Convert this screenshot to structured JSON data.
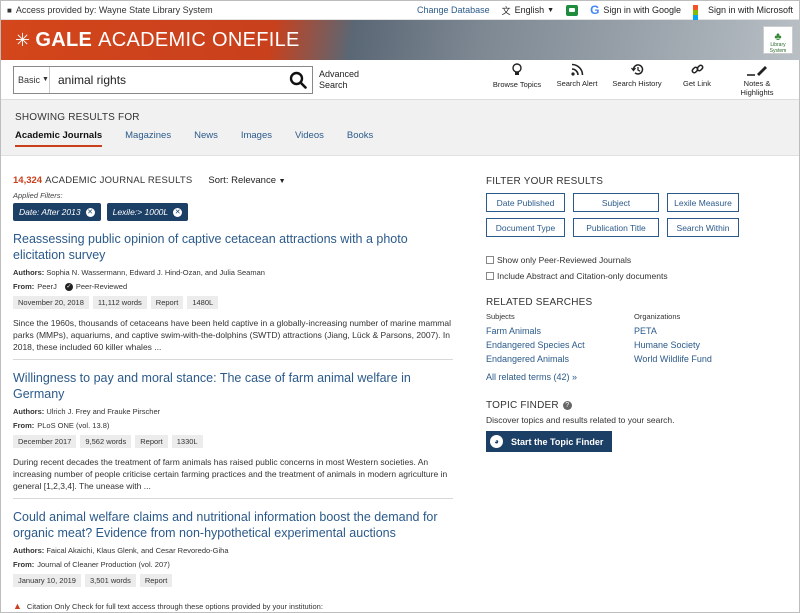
{
  "topbar": {
    "access_text": "Access provided by: Wayne State Library System",
    "change_db": "Change Database",
    "language": "English",
    "google_signin": "Sign in with Google",
    "ms_signin": "Sign in with Microsoft"
  },
  "header": {
    "brand_bold": "GALE",
    "brand_rest": "ACADEMIC ONEFILE",
    "library_logo_text": "Library System"
  },
  "search": {
    "mode": "Basic",
    "query": "animal rights",
    "advanced_line1": "Advanced",
    "advanced_line2": "Search"
  },
  "tools": [
    {
      "label": "Browse Topics",
      "icon": "lightbulb-icon"
    },
    {
      "label": "Search Alert",
      "icon": "rss-icon"
    },
    {
      "label": "Search History",
      "icon": "history-icon"
    },
    {
      "label": "Get Link",
      "icon": "link-icon"
    },
    {
      "label": "Notes & Highlights",
      "icon": "pen-icon"
    }
  ],
  "results_for": {
    "label": "SHOWING RESULTS FOR",
    "tabs": [
      "Academic Journals",
      "Magazines",
      "News",
      "Images",
      "Videos",
      "Books"
    ],
    "active_tab": "Academic Journals"
  },
  "results_header": {
    "count": "14,324",
    "label": "ACADEMIC JOURNAL RESULTS",
    "sort": "Sort: Relevance",
    "applied_label": "Applied Filters:",
    "filters": [
      "Date: After 2013",
      "Lexile:> 1000L"
    ]
  },
  "results": [
    {
      "title": "Reassessing public opinion of captive cetacean attractions with a photo elicitation survey",
      "authors_label": "Authors:",
      "authors": "Sophia N. Wassermann, Edward J. Hind-Ozan, and Julia Seaman",
      "from_label": "From:",
      "from": "PeerJ",
      "peer_reviewed": "Peer-Reviewed",
      "meta": [
        "November 20, 2018",
        "11,112 words",
        "Report",
        "1480L"
      ],
      "snippet": "Since the 1960s, thousands of cetaceans have been held captive in a globally-increasing number of marine mammal parks (MMPs), aquariums, and captive swim-with-the-dolphins (SWTD) attractions (Jiang, Lück & Parsons, 2007). In 2018, these included 60 killer whales ..."
    },
    {
      "title": "Willingness to pay and moral stance: The case of farm animal welfare in Germany",
      "authors_label": "Authors:",
      "authors": "Ulrich J. Frey and Frauke Pirscher",
      "from_label": "From:",
      "from": "PLoS ONE (vol. 13.8)",
      "meta": [
        "December 2017",
        "9,562 words",
        "Report",
        "1330L"
      ],
      "snippet": "During recent decades the treatment of farm animals has raised public concerns in most Western societies. An increasing number of people criticise certain farming practices and the treatment of animals in modern agriculture in general [1,2,3,4]. The unease with ..."
    },
    {
      "title": "Could animal welfare claims and nutritional information boost the demand for organic meat? Evidence from non-hypothetical experimental auctions",
      "authors_label": "Authors:",
      "authors": "Faical Akaichi, Klaus Glenk, and Cesar Revoredo-Giha",
      "from_label": "From:",
      "from": "Journal of Cleaner Production (vol. 207)",
      "meta": [
        "January 10, 2019",
        "3,501 words",
        "Report"
      ]
    }
  ],
  "bottom_notice": "Citation Only Check for full text access through these options provided by your institution:",
  "sidebar": {
    "filter_heading": "FILTER YOUR RESULTS",
    "filter_buttons": [
      "Date Published",
      "Subject",
      "Lexile Measure",
      "Document Type",
      "Publication Title",
      "Search Within"
    ],
    "checkbox_peer": "Show only Peer-Reviewed Journals",
    "checkbox_abstract": "Include Abstract and Citation-only documents",
    "related_heading": "RELATED SEARCHES",
    "subjects_label": "Subjects",
    "subjects": [
      "Farm Animals",
      "Endangered Species Act",
      "Endangered Animals"
    ],
    "orgs_label": "Organizations",
    "orgs": [
      "PETA",
      "Humane Society",
      "World Wildlife Fund"
    ],
    "all_related": "All related terms (42) »",
    "topic_heading": "TOPIC FINDER",
    "topic_desc": "Discover topics and results related to your search.",
    "topic_button": "Start the Topic Finder"
  },
  "colors": {
    "brand_orange": "#c8401c",
    "link_blue": "#2b5a8a",
    "navy": "#1c3f66"
  }
}
